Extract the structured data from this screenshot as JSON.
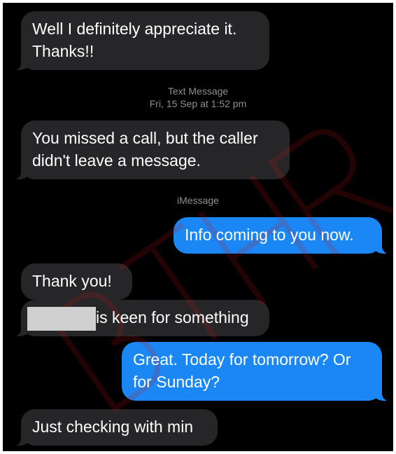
{
  "messages": [
    {
      "lines": [
        "Well I definitely appreciate it.",
        "Thanks!!"
      ]
    },
    {
      "header_service": "Text Message",
      "header_time": "Fri, 15 Sep at 1:52 pm"
    },
    {
      "lines": [
        "You missed a call, but the caller",
        "didn't leave a message."
      ]
    },
    {
      "header_service": "iMessage"
    },
    {
      "text": "Info coming to you now."
    },
    {
      "text": "Thank you!"
    },
    {
      "text_after_redaction": "is keen for something"
    },
    {
      "lines": [
        "Great. Today for tomorrow? Or",
        "for Sunday?"
      ]
    },
    {
      "text": "Just checking with min"
    }
  ],
  "colors": {
    "background": "#000000",
    "incoming_bubble": "#262628",
    "outgoing_bubble": "#1a87f5",
    "meta_text": "#8e8e93",
    "watermark": "#c41414"
  },
  "watermark": {
    "letters": "BTHR"
  }
}
